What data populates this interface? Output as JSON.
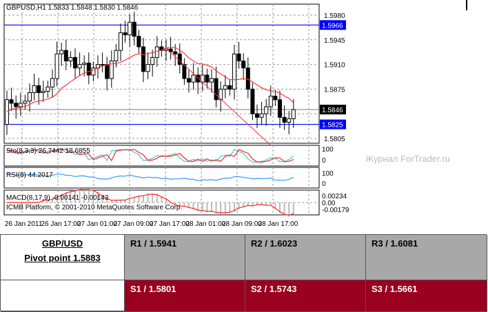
{
  "chart_data": {
    "type": "candlestick",
    "title": "GBPUSD,H1",
    "ohlc_header": [
      "1.5833",
      "1.5848",
      "1.5830",
      "1.5846"
    ],
    "y_ticks": [
      "1.5980",
      "1.5945",
      "1.5910",
      "1.5875",
      "1.5805"
    ],
    "ylim": [
      1.5795,
      1.6
    ],
    "levels": [
      {
        "value": 1.5966,
        "label": "1.5966",
        "color": "#0000ff"
      },
      {
        "value": 1.5825,
        "label": "1.5825",
        "color": "#0000ff"
      },
      {
        "value": 1.5846,
        "label": "1.5846",
        "color": "#000000"
      }
    ],
    "closes": [
      1.5825,
      1.586,
      1.5855,
      1.585,
      1.5855,
      1.5858,
      1.587,
      1.588,
      1.587,
      1.5872,
      1.5878,
      1.589,
      1.5925,
      1.593,
      1.5915,
      1.592,
      1.5905,
      1.591,
      1.5912,
      1.5895,
      1.5905,
      1.591,
      1.591,
      1.589,
      1.5915,
      1.593,
      1.5955,
      1.5952,
      1.597,
      1.595,
      1.5935,
      1.59,
      1.591,
      1.592,
      1.5935,
      1.593,
      1.5932,
      1.5928,
      1.5925,
      1.591,
      1.589,
      1.5885,
      1.5895,
      1.5885,
      1.5895,
      1.5885,
      1.589,
      1.586,
      1.5875,
      1.588,
      1.5875,
      1.5925,
      1.5915,
      1.5905,
      1.5875,
      1.584,
      1.5835,
      1.584,
      1.585,
      1.5865,
      1.586,
      1.5835,
      1.5828,
      1.5833,
      1.5846
    ],
    "x_labels": [
      "26 Jan 2011",
      "26 Jan 17:00",
      "27 Jan 01:00",
      "27 Jan 09:00",
      "27 Jan 17:00",
      "28 Jan 01:00",
      "28 Jan 09:00",
      "28 Jan 17:00"
    ],
    "stoch": {
      "label": "Sto(8,3,3) 26.7442 18.6855",
      "ticks": [
        "100",
        "0"
      ]
    },
    "rsi": {
      "label": "RSI(8) 44.2017",
      "ticks": [
        "100",
        "0"
      ]
    },
    "macd": {
      "label": "MACD(8,17,9) -0.00141 -0.00143",
      "ticks": [
        "0.00234",
        "0.00",
        "-0.00179"
      ]
    },
    "copyright": "ICMB Platform, © 2001-2010 MetaQuotes Software Corp.",
    "watermark": "Журнал ForTrader.ru"
  },
  "pivot": {
    "pair": "GBP/USD",
    "pivot": "Pivot point 1.5883",
    "resistance": [
      "R1 / 1.5941",
      "R2 / 1.6023",
      "R3 / 1.6081"
    ],
    "support": [
      "S1 / 1.5801",
      "S2 / 1.5743",
      "S3 / 1.5661"
    ]
  }
}
